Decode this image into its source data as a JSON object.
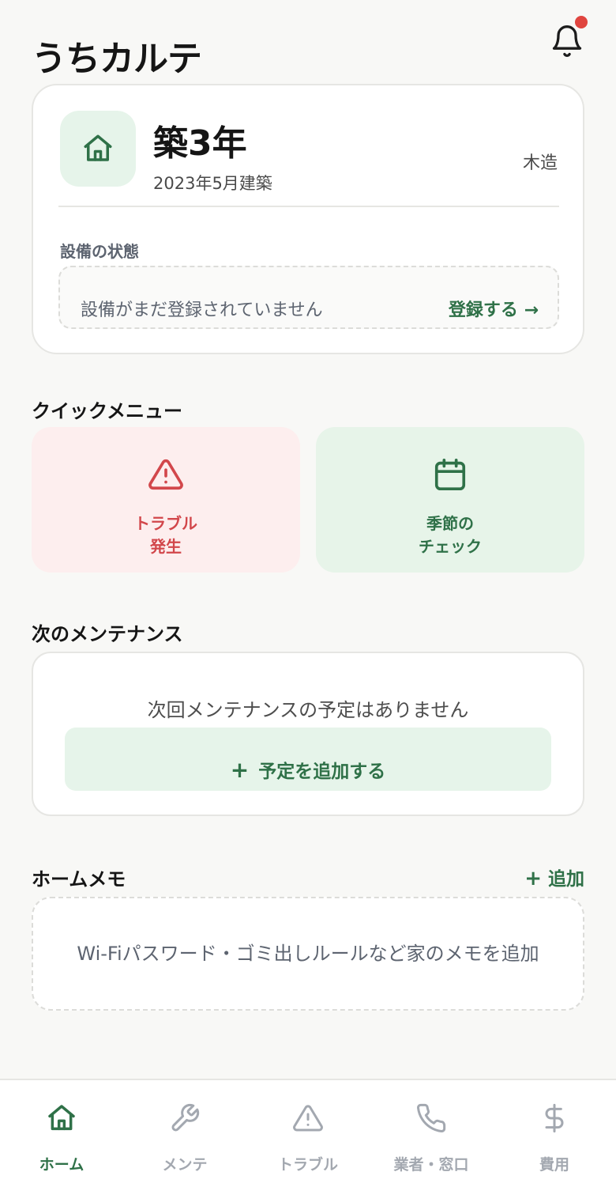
{
  "header": {
    "title": "うちカルテ",
    "notification_icon": "bell-icon",
    "has_unread": true
  },
  "house": {
    "icon": "house-icon",
    "age": "築3年",
    "built": "2023年5月建築",
    "structure": "木造",
    "equipment_label": "設備の状態",
    "equipment_empty": "設備がまだ登録されていません",
    "register_link": "登録する →"
  },
  "quick_menu": {
    "title": "クイックメニュー",
    "items": [
      {
        "line1": "トラブル",
        "line2": "発生",
        "icon": "warning-triangle-icon",
        "color": "#d2474b"
      },
      {
        "line1": "季節の",
        "line2": "チェック",
        "icon": "calendar-icon",
        "color": "#2f7148"
      }
    ]
  },
  "maintenance": {
    "title": "次のメンテナンス",
    "empty": "次回メンテナンスの予定はありません",
    "add_button": "予定を追加する"
  },
  "memo": {
    "title": "ホームメモ",
    "add_link": "追加",
    "placeholder": "Wi-Fiパスワード・ゴミ出しルールなど家のメモを追加"
  },
  "bottom_nav": {
    "items": [
      {
        "label": "ホーム",
        "icon": "home-icon",
        "active": true
      },
      {
        "label": "メンテ",
        "icon": "wrench-icon",
        "active": false
      },
      {
        "label": "トラブル",
        "icon": "warning-triangle-icon",
        "active": false
      },
      {
        "label": "業者・窓口",
        "icon": "phone-icon",
        "active": false
      },
      {
        "label": "費用",
        "icon": "dollar-icon",
        "active": false
      }
    ]
  },
  "colors": {
    "accent": "#2f7148",
    "danger": "#d2474b",
    "badge": "#e0453f",
    "inactive": "#a3a8b0"
  }
}
